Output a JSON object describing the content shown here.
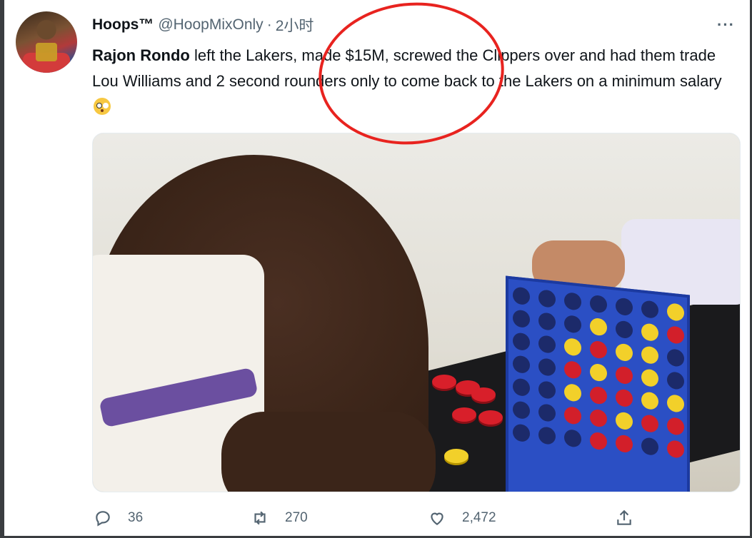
{
  "tweet": {
    "display_name": "Hoops™",
    "handle": "@HoopMixOnly",
    "separator": "·",
    "time": "2小时",
    "more_label": "···",
    "text_bold": "Rajon Rondo",
    "text_rest": " left the Lakers, made $15M, screwed the Clippers over and had them trade Lou Williams and 2 second rounders only to come back to the Lakers on a minimum salary"
  },
  "actions": {
    "reply_count": "36",
    "retweet_count": "270",
    "like_count": "2,472"
  },
  "icons": {
    "reply": "reply-icon",
    "retweet": "retweet-icon",
    "like": "heart-icon",
    "share": "share-icon",
    "emoji": "flushed-face-emoji"
  },
  "colors": {
    "annotation": "#e8231f",
    "secondary_text": "#536471"
  }
}
